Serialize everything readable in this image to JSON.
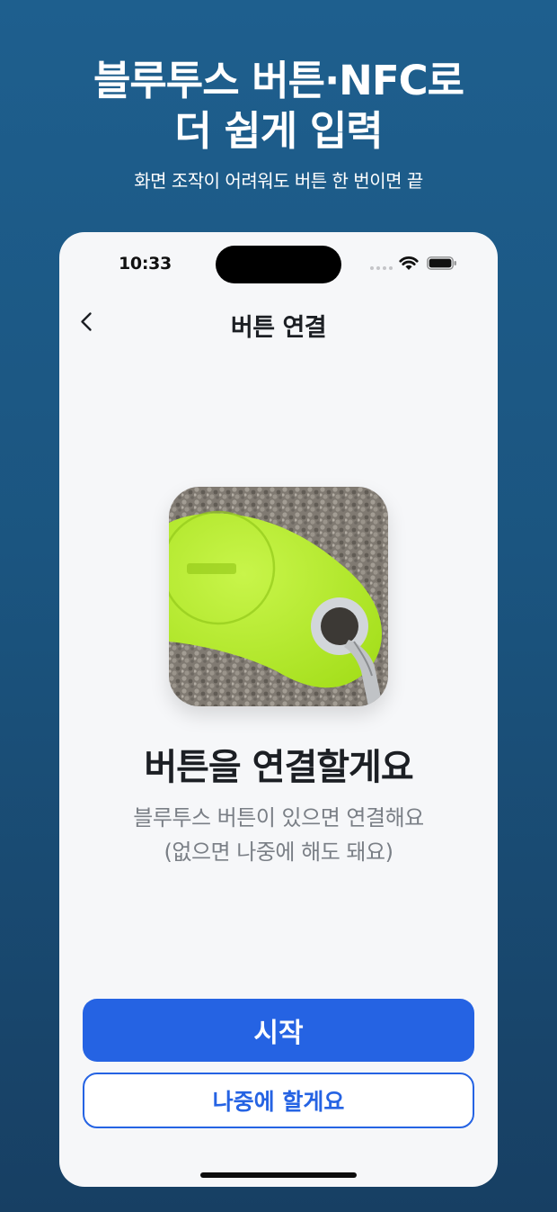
{
  "promo": {
    "title_line1": "블루투스 버튼·NFC로",
    "title_line2": "더 쉽게 입력",
    "subtitle": "화면 조작이 어려워도 버튼 한 번이면 끝"
  },
  "status_bar": {
    "time": "10:33"
  },
  "nav": {
    "back_icon": "chevron-left-icon",
    "title": "버튼 연결"
  },
  "main": {
    "image_desc_icon": "bluetooth-button-photo",
    "heading": "버튼을 연결할게요",
    "description_line1": "블루투스 버튼이 있으면 연결해요",
    "description_line2": "(없으면 나중에 해도 돼요)"
  },
  "actions": {
    "start_label": "시작",
    "later_label": "나중에 할게요"
  },
  "colors": {
    "accent": "#2563e3",
    "background_top": "#1e5f8e",
    "background_bottom": "#173f63",
    "screen_bg": "#f6f7f9"
  }
}
